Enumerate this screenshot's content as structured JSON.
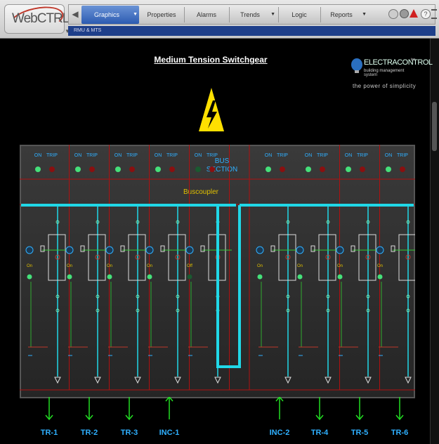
{
  "app": {
    "logo_text": "WebCTRL",
    "nav": [
      {
        "label": "Graphics"
      },
      {
        "label": "Properties"
      },
      {
        "label": "Alarms"
      },
      {
        "label": "Trends"
      },
      {
        "label": "Logic"
      },
      {
        "label": "Reports"
      }
    ],
    "breadcrumb": "RMU & MTS",
    "top_icons": [
      "alarm-icon",
      "help-icon",
      "flag-icon",
      "info-icon",
      "menu-icon"
    ]
  },
  "graphic": {
    "title": "Medium Tension Switchgear",
    "brand": {
      "name": "ELECTRACONTROL",
      "suffix": "inc",
      "sub": "building management system",
      "tagline": "the power of simplicity"
    },
    "bus_section_label": [
      "BUS",
      "SECTION"
    ],
    "buscoupler_label": "Buscoupler",
    "on_label": "ON",
    "trip_label": "TRIP",
    "colors": {
      "bus": "#20d8e8",
      "frame": "#b01010",
      "panel": "#2a2a2a",
      "led_on": "#45e07a",
      "led_trip": "#8a1010",
      "arrow": "#22dd22",
      "label": "#2fb0ff"
    },
    "feeders": [
      {
        "name": "TR-1",
        "state": "On",
        "direction": "down"
      },
      {
        "name": "TR-2",
        "state": "On",
        "direction": "down"
      },
      {
        "name": "TR-3",
        "state": "On",
        "direction": "down"
      },
      {
        "name": "INC-1",
        "state": "On",
        "direction": "up"
      },
      {
        "name": "",
        "state": "Off",
        "direction": "none"
      },
      {
        "name": "INC-2",
        "state": "On",
        "direction": "up"
      },
      {
        "name": "TR-4",
        "state": "On",
        "direction": "down"
      },
      {
        "name": "TR-5",
        "state": "On",
        "direction": "down"
      },
      {
        "name": "TR-6",
        "state": "On",
        "direction": "down"
      }
    ]
  }
}
